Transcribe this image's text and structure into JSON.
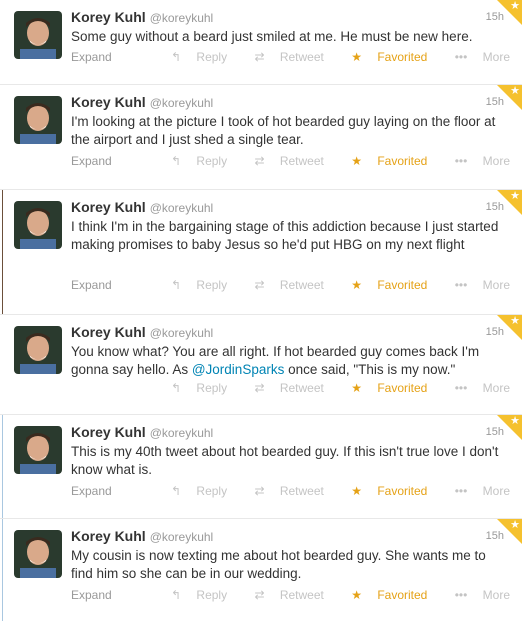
{
  "tweets": [
    {
      "name": "Korey Kuhl",
      "handle": "@koreykuhl",
      "time": "15h",
      "text": "Some guy without a beard just smiled at me. He must be new here.",
      "expand": "Expand",
      "reply": "Reply",
      "retweet": "Retweet",
      "favorited": "Favorited",
      "more": "More"
    },
    {
      "name": "Korey Kuhl",
      "handle": "@koreykuhl",
      "time": "15h",
      "text": "I'm looking at the picture I took of hot bearded guy laying on the floor at the airport and I just shed a single tear.",
      "expand": "Expand",
      "reply": "Reply",
      "retweet": "Retweet",
      "favorited": "Favorited",
      "more": "More"
    },
    {
      "name": "Korey Kuhl",
      "handle": "@koreykuhl",
      "time": "15h",
      "text": "I think I'm in the bargaining stage of this addiction because I just started making promises to baby Jesus so he'd put HBG on my next flight",
      "expand": "Expand",
      "reply": "Reply",
      "retweet": "Retweet",
      "favorited": "Favorited",
      "more": "More"
    },
    {
      "name": "Korey Kuhl",
      "handle": "@koreykuhl",
      "time": "15h",
      "text_before": "You know what? You are all right. If hot bearded guy comes back I'm gonna say hello. As ",
      "mention": "@JordinSparks",
      "text_after": " once said, \"This is my now.\"",
      "reply": "Reply",
      "retweet": "Retweet",
      "favorited": "Favorited",
      "more": "More"
    },
    {
      "name": "Korey Kuhl",
      "handle": "@koreykuhl",
      "time": "15h",
      "text": "This is my 40th tweet about hot bearded guy. If this isn't true love I don't know what is.",
      "expand": "Expand",
      "reply": "Reply",
      "retweet": "Retweet",
      "favorited": "Favorited",
      "more": "More"
    },
    {
      "name": "Korey Kuhl",
      "handle": "@koreykuhl",
      "time": "15h",
      "text": "My cousin is now texting me about hot bearded guy. She wants me to find him so she can be in our wedding.",
      "expand": "Expand",
      "reply": "Reply",
      "retweet": "Retweet",
      "favorited": "Favorited",
      "more": "More"
    }
  ],
  "colors": {
    "favorite_accent": "#f5c12e",
    "link": "#0084b4",
    "divider_blue": "#a9c7e0",
    "divider_brown": "#6b4f3a"
  },
  "icons": {
    "reply": "reply-arrow-icon",
    "retweet": "retweet-icon",
    "favorite": "star-icon",
    "more": "ellipsis-icon",
    "favorited_corner": "star-icon"
  }
}
